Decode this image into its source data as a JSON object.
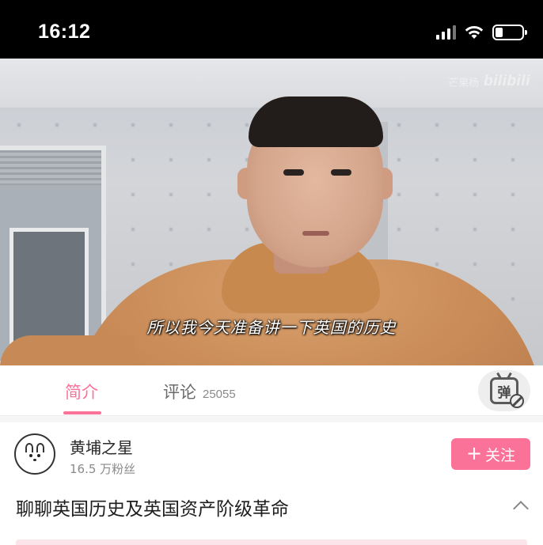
{
  "status_bar": {
    "time": "16:12"
  },
  "video": {
    "watermark_text": "芒果杨",
    "watermark_logo": "bilibili",
    "subtitle": "所以我今天准备讲一下英国的历史"
  },
  "tabs": {
    "intro_label": "简介",
    "comment_label": "评论",
    "comment_count": "25055",
    "danmaku_char": "弹"
  },
  "author": {
    "name": "黄埔之星",
    "fans": "16.5 万粉丝",
    "follow_plus": "+",
    "follow_label": "关注"
  },
  "video_title": "聊聊英国历史及英国资产阶级革命",
  "colors": {
    "accent": "#fb7299",
    "status_bar_bg": "#000000"
  }
}
